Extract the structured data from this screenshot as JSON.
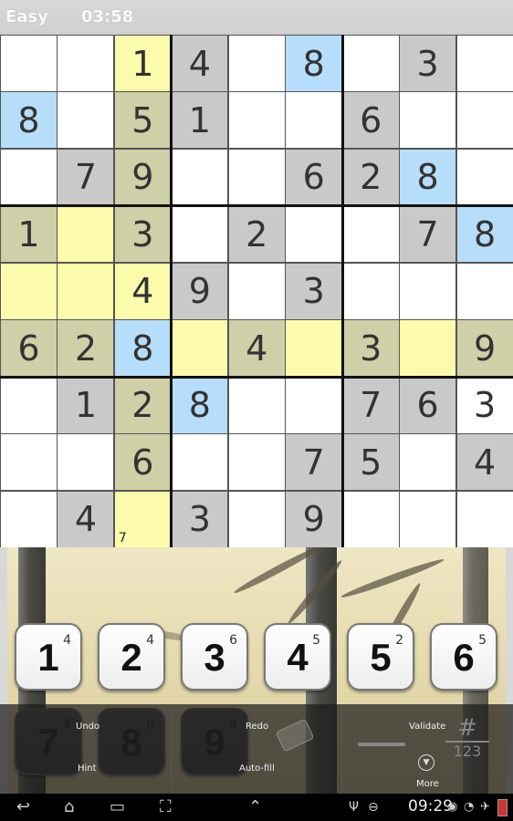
{
  "header": {
    "difficulty": "Easy",
    "timer": "03:58"
  },
  "board": {
    "rows": [
      [
        "",
        "",
        "1",
        "4",
        "",
        "8",
        "",
        "3",
        ""
      ],
      [
        "8",
        "",
        "5",
        "1",
        "",
        "",
        "6",
        "",
        ""
      ],
      [
        "",
        "7",
        "9",
        "",
        "",
        "6",
        "2",
        "8",
        ""
      ],
      [
        "1",
        "",
        "3",
        "",
        "2",
        "",
        "",
        "7",
        "8"
      ],
      [
        "",
        "",
        "4",
        "9",
        "",
        "3",
        "",
        "",
        ""
      ],
      [
        "6",
        "2",
        "8",
        "",
        "4",
        "",
        "3",
        "",
        "9"
      ],
      [
        "",
        "1",
        "2",
        "8",
        "",
        "",
        "7",
        "6",
        "3"
      ],
      [
        "",
        "",
        "6",
        "",
        "",
        "7",
        "5",
        "",
        "4"
      ],
      [
        "",
        "4",
        "",
        "3",
        "",
        "9",
        "",
        "",
        ""
      ]
    ],
    "fills": [
      [
        "w",
        "w",
        "y",
        "g",
        "w",
        "b",
        "w",
        "g",
        "w"
      ],
      [
        "b",
        "w",
        "o",
        "g",
        "w",
        "w",
        "g",
        "w",
        "w"
      ],
      [
        "w",
        "g",
        "o",
        "w",
        "w",
        "g",
        "g",
        "b",
        "w"
      ],
      [
        "o",
        "y",
        "o",
        "w",
        "g",
        "w",
        "w",
        "g",
        "b"
      ],
      [
        "y",
        "y",
        "y",
        "g",
        "w",
        "g",
        "w",
        "w",
        "w"
      ],
      [
        "o",
        "o",
        "b",
        "y",
        "o",
        "y",
        "o",
        "y",
        "o"
      ],
      [
        "w",
        "g",
        "o",
        "b",
        "w",
        "w",
        "g",
        "g",
        "w"
      ],
      [
        "w",
        "w",
        "o",
        "w",
        "w",
        "g",
        "g",
        "w",
        "g"
      ],
      [
        "w",
        "g",
        "y",
        "g",
        "w",
        "g",
        "w",
        "w",
        "w"
      ]
    ],
    "palette": {
      "w": "#ffffff",
      "g": "#c9c9c9",
      "y": "#fbfbab",
      "b": "#b6defa",
      "o": "#cfcfa8"
    },
    "pencil_marks": [
      {
        "row": 8,
        "col": 2,
        "text": "7"
      }
    ]
  },
  "number_keys": [
    {
      "digit": "1",
      "count": "4"
    },
    {
      "digit": "2",
      "count": "4"
    },
    {
      "digit": "3",
      "count": "6"
    },
    {
      "digit": "4",
      "count": "5"
    },
    {
      "digit": "5",
      "count": "2"
    },
    {
      "digit": "6",
      "count": "5"
    },
    {
      "digit": "7",
      "count": "4"
    },
    {
      "digit": "8",
      "count": "6"
    },
    {
      "digit": "9",
      "count": "4"
    }
  ],
  "menu": {
    "undo": "Undo",
    "redo": "Redo",
    "validate": "Validate",
    "hint": "Hint",
    "autofill": "Auto-fill",
    "more": "More",
    "notes_tool": "#",
    "notes_tool_sub": "123",
    "icons": [
      "eraser-icon",
      "pencil-icon",
      "notes-icon",
      "more-icon"
    ]
  },
  "system_bar": {
    "clock": "09:29",
    "icons": [
      "back-icon",
      "home-icon",
      "recent-apps-icon",
      "screenshot-icon",
      "up-icon",
      "usb-icon",
      "minus-icon",
      "eye-icon",
      "wifi-icon",
      "airplane-icon",
      "battery-icon"
    ]
  }
}
